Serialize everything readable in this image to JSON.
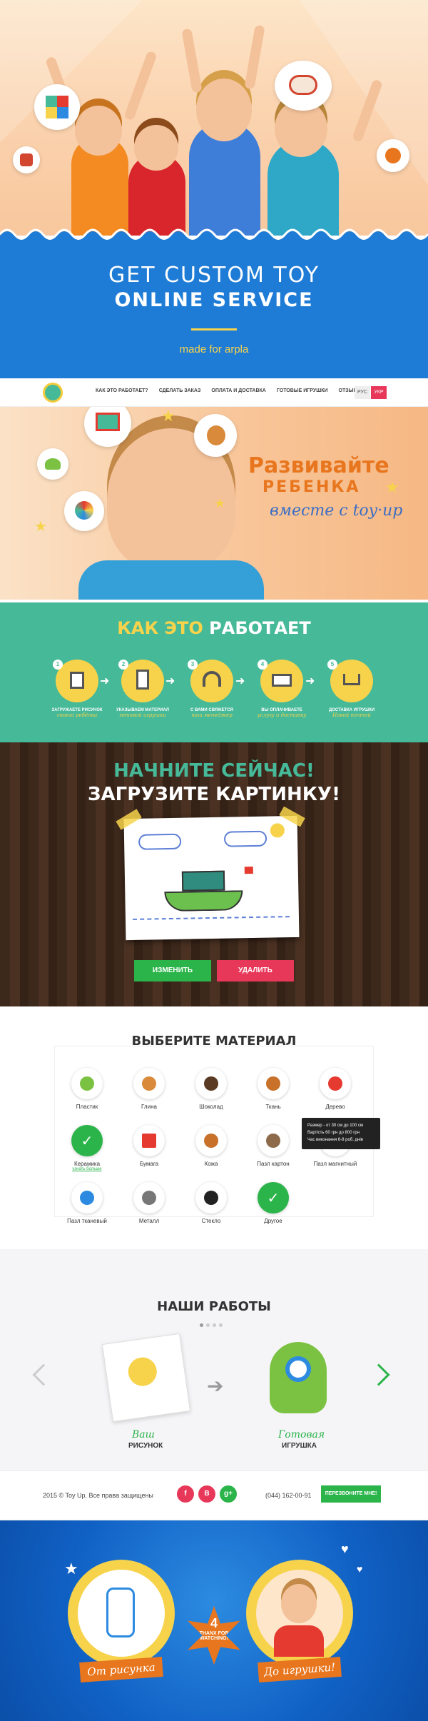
{
  "hero": {
    "title_line1": "GET CUSTOM TOY",
    "title_line2": "ONLINE SERVICE",
    "made_for": "made for arpla"
  },
  "nav": {
    "items": [
      "КАК ЭТО РАБОТАЕТ?",
      "СДЕЛАТЬ ЗАКАЗ",
      "ОПЛАТА И ДОСТАВКА",
      "ГОТОВЫЕ ИГРУШКИ",
      "ОТЗЫВЫ"
    ],
    "lang_ru": "РУС",
    "lang_ua": "УКР"
  },
  "banner": {
    "line1": "Развивайте",
    "line2": "РЕБЕНКА",
    "line3": "вместе с toy·up"
  },
  "how": {
    "title_yellow": "КАК ЭТО",
    "title_white": "РАБОТАЕТ",
    "steps": [
      {
        "num": "1",
        "label": "ЗАГРУЖАЕТЕ РИСУНОК",
        "sub": "своего ребёнка"
      },
      {
        "num": "2",
        "label": "УКАЗЫВАЕМ МАТЕРИАЛ",
        "sub": "готовой игрушки"
      },
      {
        "num": "3",
        "label": "С ВАМИ СВЯЖЕТСЯ",
        "sub": "наш менеджер"
      },
      {
        "num": "4",
        "label": "ВЫ ОПЛАЧИВАЕТЕ",
        "sub": "услугу и доставку"
      },
      {
        "num": "5",
        "label": "ДОСТАВКА ИГРУШКИ",
        "sub": "Новой почтой"
      }
    ]
  },
  "upload": {
    "title_green": "НАЧНИТЕ СЕЙЧАС!",
    "title_white": "ЗАГРУЗИТЕ КАРТИНКУ!",
    "edit_label": "ИЗМЕНИТЬ",
    "delete_label": "УДАЛИТЬ"
  },
  "materials": {
    "title": "ВЫБЕРИТЕ МАТЕРИАЛ",
    "items": [
      "Пластик",
      "Глина",
      "Шоколад",
      "Ткань",
      "Дерево",
      "Керамика",
      "Бумага",
      "Кожа",
      "Пазл картон",
      "Пазл магнитный",
      "Пазл тканевый",
      "Металл",
      "Стекло",
      "Другое"
    ],
    "more_link": "узнать больше",
    "tooltip": [
      "Размер - от 30 см до 100 см",
      "Вартість 60 грн до 800 грн",
      "Час виконання 6-8 роб. днів"
    ]
  },
  "works": {
    "title": "НАШИ РАБОТЫ",
    "your": "Ваш",
    "drawing": "РИСУНОК",
    "ready": "Готовая",
    "toy": "ИГРУШКА"
  },
  "footer": {
    "copyright": "2015 © Toy Up. Все права защищены",
    "phone": "(044) 162-00-91",
    "callback": "ПЕРЕЗВОНИТЕ МНЕ!",
    "social": [
      "f",
      "В",
      "g+"
    ]
  },
  "final": {
    "left": "От рисунка",
    "right": "До игрушки!",
    "thanks_num": "4",
    "thanks1": "THANX FOR",
    "thanks2": "WATCHING!"
  },
  "colors": {
    "blue": "#1f7cd6",
    "green": "#46b999",
    "yellow": "#f7d34b",
    "orange": "#e8761e",
    "red": "#e8385a",
    "btn_green": "#2bb44a"
  }
}
